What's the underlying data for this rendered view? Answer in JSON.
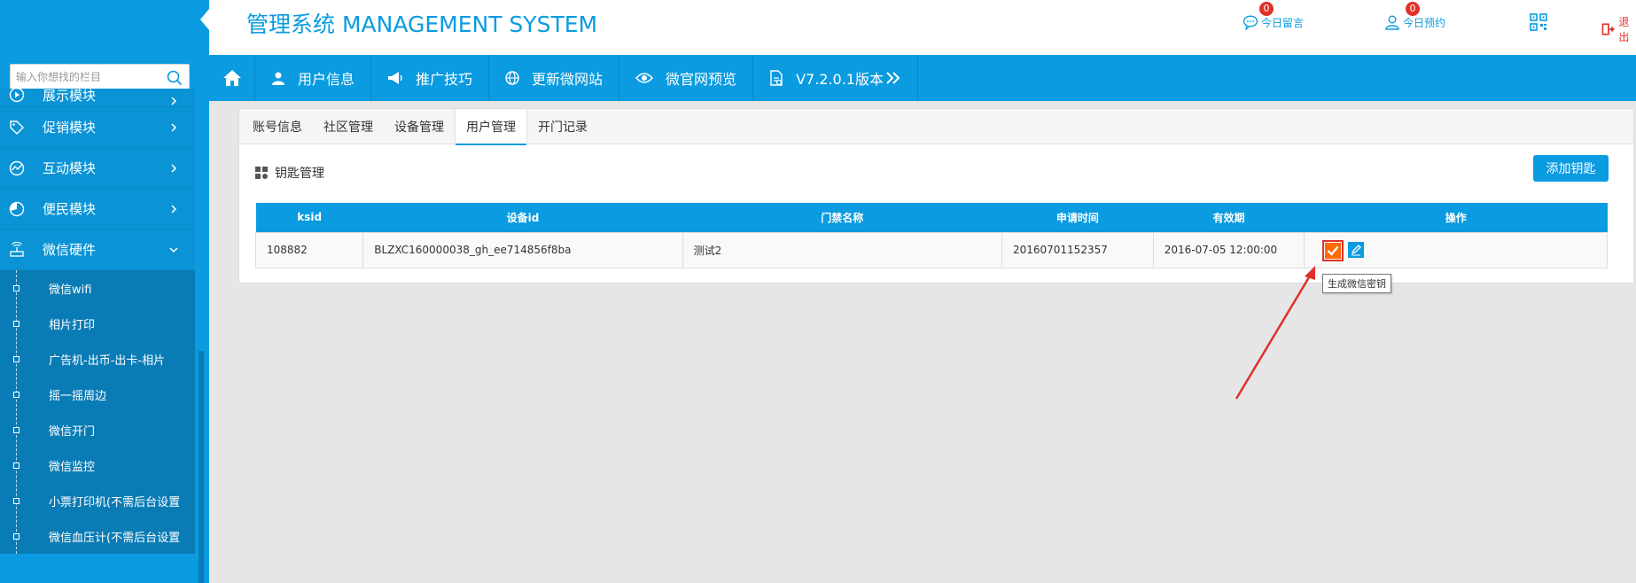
{
  "app": {
    "title": "管理系统 MANAGEMENT SYSTEM"
  },
  "header": {
    "links": [
      {
        "label": "今日预约",
        "badge": "0",
        "icon": "user-icon"
      },
      {
        "label": "今日留言",
        "badge": "0",
        "icon": "message-icon"
      }
    ],
    "qr_icon": "qrcode-icon",
    "logout_label": "退出"
  },
  "search": {
    "placeholder": "输入你想找的栏目"
  },
  "sidebar": {
    "items": [
      {
        "label": "展示模块",
        "icon": "play-circle-icon",
        "expanded": false
      },
      {
        "label": "促销模块",
        "icon": "tag-icon",
        "expanded": false
      },
      {
        "label": "互动模块",
        "icon": "chart-line-icon",
        "expanded": false
      },
      {
        "label": "便民模块",
        "icon": "pie-icon",
        "expanded": false
      },
      {
        "label": "微信硬件",
        "icon": "router-icon",
        "expanded": true
      }
    ],
    "subitems": [
      "微信wifi",
      "相片打印",
      "广告机-出币-出卡-相片",
      "摇一摇周边",
      "微信开门",
      "微信监控",
      "小票打印机(不需后台设置",
      "微信血压计(不需后台设置"
    ]
  },
  "navbar": {
    "items": [
      {
        "label": "用户信息",
        "icon": "user-icon"
      },
      {
        "label": "推广技巧",
        "icon": "megaphone-icon"
      },
      {
        "label": "更新微网站",
        "icon": "globe-icon"
      },
      {
        "label": "微官网预览",
        "icon": "eye-icon"
      },
      {
        "label": "V7.2.0.1版本",
        "icon": "document-icon"
      }
    ]
  },
  "tabs": [
    "账号信息",
    "社区管理",
    "设备管理",
    "用户管理",
    "开门记录"
  ],
  "active_tab": "用户管理",
  "section": {
    "title": "钥匙管理",
    "add_button": "添加钥匙"
  },
  "table": {
    "headers": [
      "ksid",
      "设备id",
      "门禁名称",
      "申请时间",
      "有效期",
      "操作"
    ],
    "rows": [
      [
        "108882",
        "BLZXC160000038_gh_ee714856f8ba",
        "测试2",
        "20160701152357",
        "2016-07-05 12:00:00",
        ""
      ]
    ]
  },
  "tooltip": "生成微信密钥",
  "colors": {
    "primary": "#0a9be0",
    "accent_orange": "#ff6a00",
    "alert_red": "#e0302a"
  }
}
